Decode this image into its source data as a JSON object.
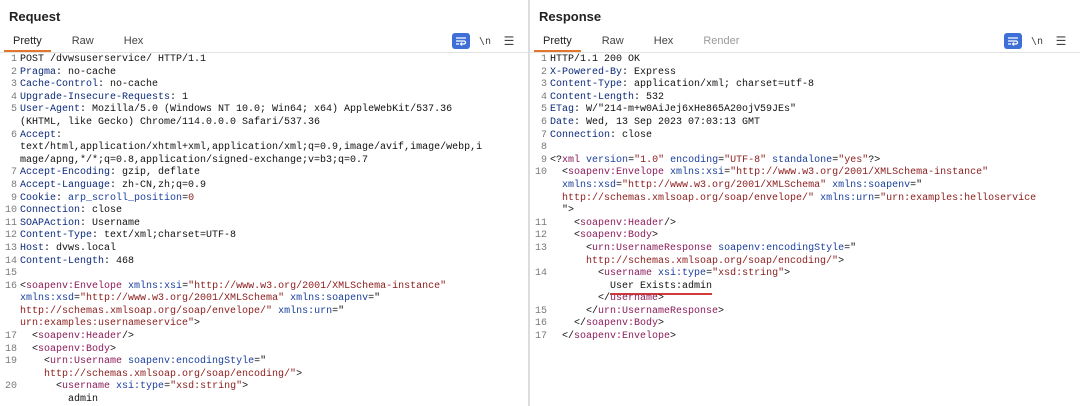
{
  "layout_switch": {
    "buttons": [
      {
        "name": "split-horizontal",
        "active": true
      },
      {
        "name": "split-vertical",
        "active": false
      },
      {
        "name": "single-pane",
        "active": false
      }
    ]
  },
  "request": {
    "title": "Request",
    "tabs": [
      {
        "label": "Pretty",
        "active": true
      },
      {
        "label": "Raw"
      },
      {
        "label": "Hex"
      }
    ],
    "tools": {
      "newline_label": "\\n"
    },
    "lines": [
      {
        "n": "1",
        "segs": [
          {
            "t": "POST /dvwsuserservice/ HTTP/1.1"
          }
        ]
      },
      {
        "n": "2",
        "segs": [
          {
            "t": "Pragma",
            "c": "name"
          },
          {
            "t": ": no-cache"
          }
        ]
      },
      {
        "n": "3",
        "segs": [
          {
            "t": "Cache-Control",
            "c": "name"
          },
          {
            "t": ": no-cache"
          }
        ]
      },
      {
        "n": "4",
        "segs": [
          {
            "t": "Upgrade-Insecure-Requests",
            "c": "name"
          },
          {
            "t": ": 1"
          }
        ]
      },
      {
        "n": "5",
        "segs": [
          {
            "t": "User-Agent",
            "c": "name"
          },
          {
            "t": ": Mozilla/5.0 (Windows NT 10.0; Win64; x64) AppleWebKit/537.36"
          }
        ]
      },
      {
        "n": "",
        "segs": [
          {
            "t": "(KHTML, like Gecko) Chrome/114.0.0.0 Safari/537.36"
          }
        ]
      },
      {
        "n": "6",
        "segs": [
          {
            "t": "Accept",
            "c": "name"
          },
          {
            "t": ":"
          }
        ]
      },
      {
        "n": "",
        "segs": [
          {
            "t": "text/html,application/xhtml+xml,application/xml;q=0.9,image/avif,image/webp,i"
          }
        ]
      },
      {
        "n": "",
        "segs": [
          {
            "t": "mage/apng,*/*;q=0.8,application/signed-exchange;v=b3;q=0.7"
          }
        ]
      },
      {
        "n": "7",
        "segs": [
          {
            "t": "Accept-Encoding",
            "c": "name"
          },
          {
            "t": ": gzip, deflate"
          }
        ]
      },
      {
        "n": "8",
        "segs": [
          {
            "t": "Accept-Language",
            "c": "name"
          },
          {
            "t": ": zh-CN,zh;q=0.9"
          }
        ]
      },
      {
        "n": "9",
        "segs": [
          {
            "t": "Cookie",
            "c": "name"
          },
          {
            "t": ": "
          },
          {
            "t": "arp_scroll_position",
            "c": "attr"
          },
          {
            "t": "="
          },
          {
            "t": "0",
            "c": "val"
          }
        ]
      },
      {
        "n": "10",
        "segs": [
          {
            "t": "Connection",
            "c": "name"
          },
          {
            "t": ": close"
          }
        ]
      },
      {
        "n": "11",
        "segs": [
          {
            "t": "SOAPAction",
            "c": "name"
          },
          {
            "t": ": Username"
          }
        ]
      },
      {
        "n": "12",
        "segs": [
          {
            "t": "Content-Type",
            "c": "name"
          },
          {
            "t": ": text/xml;charset=UTF-8"
          }
        ]
      },
      {
        "n": "13",
        "segs": [
          {
            "t": "Host",
            "c": "name"
          },
          {
            "t": ": dvws.local"
          }
        ]
      },
      {
        "n": "14",
        "segs": [
          {
            "t": "Content-Length",
            "c": "name"
          },
          {
            "t": ": 468"
          }
        ]
      },
      {
        "n": "15",
        "segs": [
          {
            "t": ""
          }
        ]
      },
      {
        "n": "16",
        "segs": [
          {
            "t": "<"
          },
          {
            "t": "soapenv:Envelope",
            "c": "tag"
          },
          {
            "t": " "
          },
          {
            "t": "xmlns:xsi",
            "c": "attr"
          },
          {
            "t": "="
          },
          {
            "t": "\"http://www.w3.org/2001/XMLSchema-instance\"",
            "c": "val"
          }
        ]
      },
      {
        "n": "",
        "segs": [
          {
            "t": "xmlns:xsd",
            "c": "attr"
          },
          {
            "t": "="
          },
          {
            "t": "\"http://www.w3.org/2001/XMLSchema\"",
            "c": "val"
          },
          {
            "t": " "
          },
          {
            "t": "xmlns:soapenv",
            "c": "attr"
          },
          {
            "t": "=\""
          }
        ]
      },
      {
        "n": "",
        "segs": [
          {
            "t": "http://schemas.xmlsoap.org/soap/envelope/\"",
            "c": "val"
          },
          {
            "t": " "
          },
          {
            "t": "xmlns:urn",
            "c": "attr"
          },
          {
            "t": "=\""
          }
        ]
      },
      {
        "n": "",
        "segs": [
          {
            "t": "urn:examples:usernameservice\"",
            "c": "val"
          },
          {
            "t": ">"
          }
        ]
      },
      {
        "n": "17",
        "segs": [
          {
            "t": "  <"
          },
          {
            "t": "soapenv:Header",
            "c": "tag"
          },
          {
            "t": "/>"
          }
        ]
      },
      {
        "n": "18",
        "segs": [
          {
            "t": "  <"
          },
          {
            "t": "soapenv:Body",
            "c": "tag"
          },
          {
            "t": ">"
          }
        ]
      },
      {
        "n": "19",
        "segs": [
          {
            "t": "    <"
          },
          {
            "t": "urn:Username",
            "c": "tag"
          },
          {
            "t": " "
          },
          {
            "t": "soapenv:encodingStyle",
            "c": "attr"
          },
          {
            "t": "=\""
          }
        ]
      },
      {
        "n": "",
        "segs": [
          {
            "t": "    "
          },
          {
            "t": "http://schemas.xmlsoap.org/soap/encoding/\"",
            "c": "val"
          },
          {
            "t": ">"
          }
        ]
      },
      {
        "n": "20",
        "segs": [
          {
            "t": "      <"
          },
          {
            "t": "username",
            "c": "tag"
          },
          {
            "t": " "
          },
          {
            "t": "xsi:type",
            "c": "attr"
          },
          {
            "t": "="
          },
          {
            "t": "\"xsd:string\"",
            "c": "val"
          },
          {
            "t": ">"
          }
        ]
      },
      {
        "n": "",
        "segs": [
          {
            "t": "        admin"
          }
        ]
      }
    ]
  },
  "response": {
    "title": "Response",
    "tabs": [
      {
        "label": "Pretty",
        "active": true
      },
      {
        "label": "Raw"
      },
      {
        "label": "Hex"
      },
      {
        "label": "Render",
        "disabled": true
      }
    ],
    "tools": {
      "newline_label": "\\n"
    },
    "lines": [
      {
        "n": "1",
        "segs": [
          {
            "t": "HTTP/1.1 200 OK"
          }
        ]
      },
      {
        "n": "2",
        "segs": [
          {
            "t": "X-Powered-By",
            "c": "name"
          },
          {
            "t": ": Express"
          }
        ]
      },
      {
        "n": "3",
        "segs": [
          {
            "t": "Content-Type",
            "c": "name"
          },
          {
            "t": ": application/xml; charset=utf-8"
          }
        ]
      },
      {
        "n": "4",
        "segs": [
          {
            "t": "Content-Length",
            "c": "name"
          },
          {
            "t": ": 532"
          }
        ]
      },
      {
        "n": "5",
        "segs": [
          {
            "t": "ETag",
            "c": "name"
          },
          {
            "t": ": W/\"214-m+w0AiJej6xHe865A20ojV59JEs\""
          }
        ]
      },
      {
        "n": "6",
        "segs": [
          {
            "t": "Date",
            "c": "name"
          },
          {
            "t": ": Wed, 13 Sep 2023 07:03:13 GMT"
          }
        ]
      },
      {
        "n": "7",
        "segs": [
          {
            "t": "Connection",
            "c": "name"
          },
          {
            "t": ": close"
          }
        ]
      },
      {
        "n": "8",
        "segs": [
          {
            "t": ""
          }
        ]
      },
      {
        "n": "9",
        "segs": [
          {
            "t": "<?"
          },
          {
            "t": "xml",
            "c": "tag"
          },
          {
            "t": " "
          },
          {
            "t": "version",
            "c": "attr"
          },
          {
            "t": "="
          },
          {
            "t": "\"1.0\"",
            "c": "val"
          },
          {
            "t": " "
          },
          {
            "t": "encoding",
            "c": "attr"
          },
          {
            "t": "="
          },
          {
            "t": "\"UTF-8\"",
            "c": "val"
          },
          {
            "t": " "
          },
          {
            "t": "standalone",
            "c": "attr"
          },
          {
            "t": "="
          },
          {
            "t": "\"yes\"",
            "c": "val"
          },
          {
            "t": "?>"
          }
        ]
      },
      {
        "n": "10",
        "segs": [
          {
            "t": "  <"
          },
          {
            "t": "soapenv:Envelope",
            "c": "tag"
          },
          {
            "t": " "
          },
          {
            "t": "xmlns:xsi",
            "c": "attr"
          },
          {
            "t": "="
          },
          {
            "t": "\"http://www.w3.org/2001/XMLSchema-instance\"",
            "c": "val"
          }
        ]
      },
      {
        "n": "",
        "segs": [
          {
            "t": "  "
          },
          {
            "t": "xmlns:xsd",
            "c": "attr"
          },
          {
            "t": "="
          },
          {
            "t": "\"http://www.w3.org/2001/XMLSchema\"",
            "c": "val"
          },
          {
            "t": " "
          },
          {
            "t": "xmlns:soapenv",
            "c": "attr"
          },
          {
            "t": "=\""
          }
        ]
      },
      {
        "n": "",
        "segs": [
          {
            "t": "  "
          },
          {
            "t": "http://schemas.xmlsoap.org/soap/envelope/\"",
            "c": "val"
          },
          {
            "t": " "
          },
          {
            "t": "xmlns:urn",
            "c": "attr"
          },
          {
            "t": "="
          },
          {
            "t": "\"urn:examples:helloservice",
            "c": "val"
          }
        ]
      },
      {
        "n": "",
        "segs": [
          {
            "t": "  \">"
          }
        ]
      },
      {
        "n": "11",
        "segs": [
          {
            "t": "    <"
          },
          {
            "t": "soapenv:Header",
            "c": "tag"
          },
          {
            "t": "/>"
          }
        ]
      },
      {
        "n": "12",
        "segs": [
          {
            "t": "    <"
          },
          {
            "t": "soapenv:Body",
            "c": "tag"
          },
          {
            "t": ">"
          }
        ]
      },
      {
        "n": "13",
        "segs": [
          {
            "t": "      <"
          },
          {
            "t": "urn:UsernameResponse",
            "c": "tag"
          },
          {
            "t": " "
          },
          {
            "t": "soapenv:encodingStyle",
            "c": "attr"
          },
          {
            "t": "=\""
          }
        ]
      },
      {
        "n": "",
        "segs": [
          {
            "t": "      "
          },
          {
            "t": "http://schemas.xmlsoap.org/soap/encoding/\"",
            "c": "val"
          },
          {
            "t": ">"
          }
        ]
      },
      {
        "n": "14",
        "segs": [
          {
            "t": "        <"
          },
          {
            "t": "username",
            "c": "tag"
          },
          {
            "t": " "
          },
          {
            "t": "xsi:type",
            "c": "attr"
          },
          {
            "t": "="
          },
          {
            "t": "\"xsd:string\"",
            "c": "val"
          },
          {
            "t": ">"
          }
        ]
      },
      {
        "n": "",
        "segs": [
          {
            "t": "          "
          },
          {
            "t": "User Exists:admin",
            "c": "hl"
          }
        ]
      },
      {
        "n": "",
        "segs": [
          {
            "t": "        </"
          },
          {
            "t": "username",
            "c": "tag"
          },
          {
            "t": ">"
          }
        ]
      },
      {
        "n": "15",
        "segs": [
          {
            "t": "      </"
          },
          {
            "t": "urn:UsernameResponse",
            "c": "tag"
          },
          {
            "t": ">"
          }
        ]
      },
      {
        "n": "16",
        "segs": [
          {
            "t": "    </"
          },
          {
            "t": "soapenv:Body",
            "c": "tag"
          },
          {
            "t": ">"
          }
        ]
      },
      {
        "n": "17",
        "segs": [
          {
            "t": "  </"
          },
          {
            "t": "soapenv:Envelope",
            "c": "tag"
          },
          {
            "t": ">"
          }
        ]
      }
    ]
  }
}
